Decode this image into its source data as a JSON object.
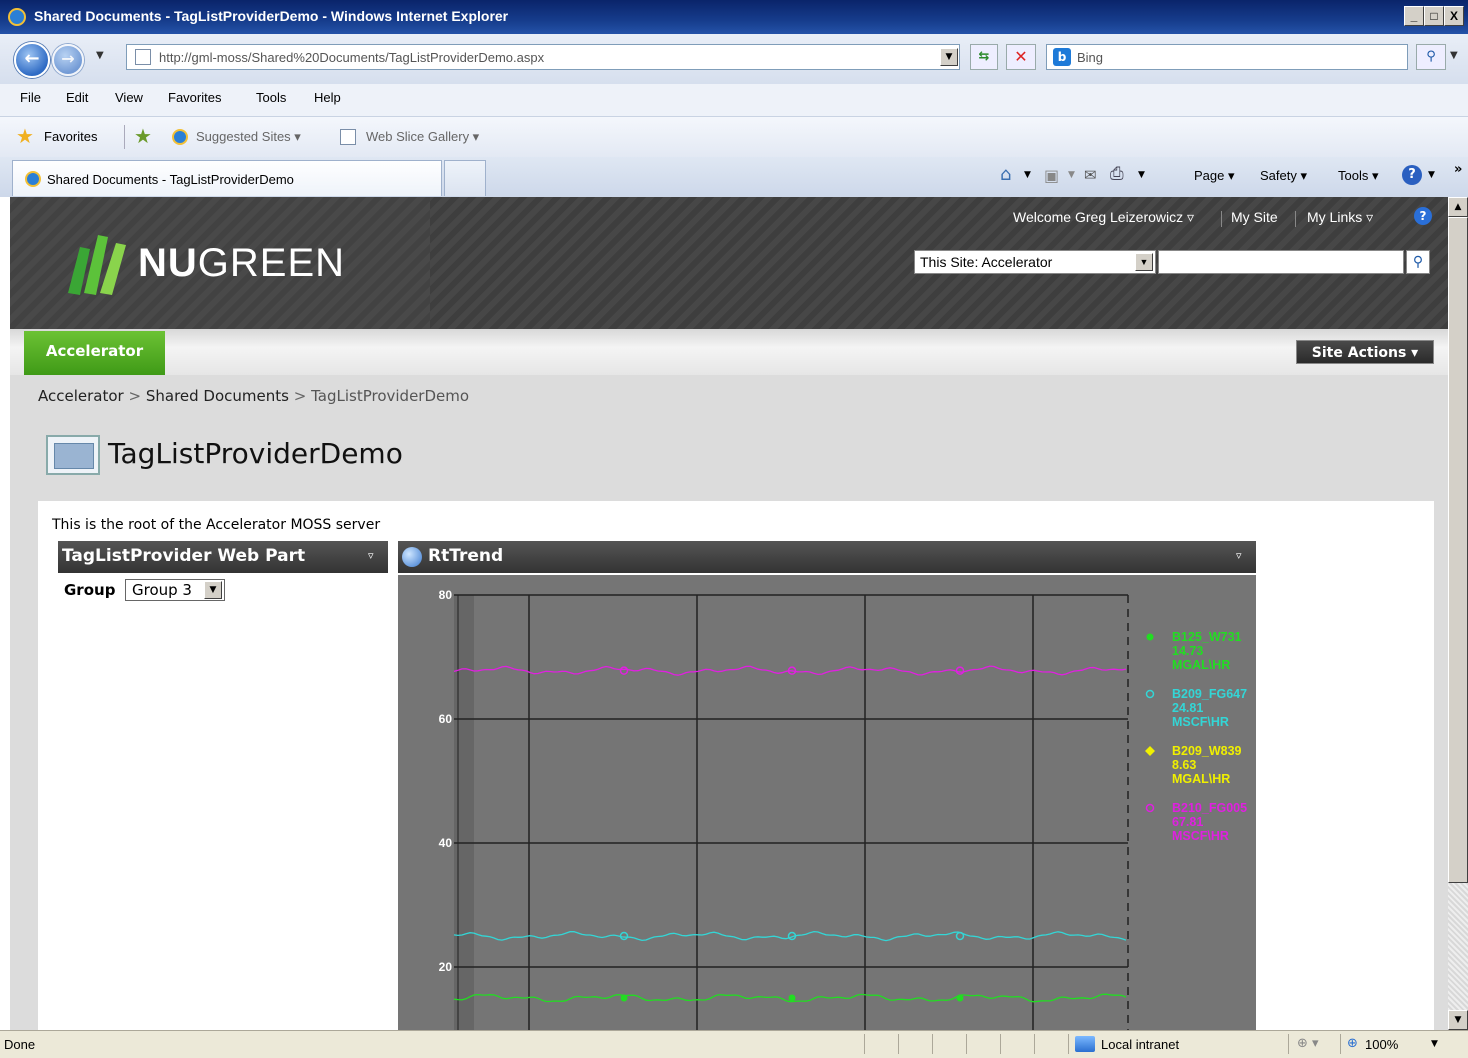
{
  "window": {
    "title": "Shared Documents - TagListProviderDemo - Windows Internet Explorer",
    "controls": [
      "_",
      "□",
      "X"
    ]
  },
  "address": {
    "url": "http://gml-moss/Shared%20Documents/TagListProviderDemo.aspx",
    "search_engine": "Bing"
  },
  "menu": [
    "File",
    "Edit",
    "View",
    "Favorites",
    "Tools",
    "Help"
  ],
  "favorites_bar": {
    "favorites_label": "Favorites",
    "items": [
      "Suggested Sites ▾",
      "Web Slice Gallery ▾"
    ]
  },
  "tabs": [
    {
      "label": "Shared Documents - TagListProviderDemo"
    }
  ],
  "command_bar": [
    "Page ▾",
    "Safety ▾",
    "Tools ▾"
  ],
  "sharepoint": {
    "welcome": "Welcome Greg Leizerowicz ▿",
    "my_site": "My Site",
    "my_links": "My Links ▿",
    "logo_bold": "NU",
    "logo_rest": "GREEN",
    "search_scope": "This Site: Accelerator",
    "site_tab": "Accelerator",
    "site_actions": "Site Actions ▾",
    "breadcrumb": [
      "Accelerator",
      "Shared Documents",
      "TagListProviderDemo"
    ],
    "breadcrumb_sep": ">",
    "page_title": "TagListProviderDemo",
    "root_note": "This is the root of the Accelerator MOSS server"
  },
  "taglist_webpart": {
    "title": "TagListProvider Web Part",
    "group_label": "Group",
    "group_value": "Group 3"
  },
  "rttrend_webpart": {
    "title": "RtTrend"
  },
  "chart_data": {
    "type": "line",
    "title": "",
    "ylim": [
      12,
      80
    ],
    "y_ticks": [
      20,
      40,
      60,
      80
    ],
    "grid": true,
    "legend_position": "right",
    "series": [
      {
        "name": "B125_W731",
        "value": "14.73",
        "unit": "MGAL\\HR",
        "color": "#22dd22",
        "marker": "dot",
        "level": 15
      },
      {
        "name": "B209_FG647",
        "value": "24.81",
        "unit": "MSCF\\HR",
        "color": "#33d6d6",
        "marker": "circle",
        "level": 25
      },
      {
        "name": "B209_W839",
        "value": "8.63",
        "unit": "MGAL\\HR",
        "color": "#f0f000",
        "marker": "diamond",
        "level": 8.63
      },
      {
        "name": "B210_FG005",
        "value": "67.81",
        "unit": "MSCF\\HR",
        "color": "#e020e0",
        "marker": "circle",
        "level": 67.8
      }
    ]
  },
  "status": {
    "left": "Done",
    "zone": "Local intranet",
    "zoom": "100%"
  }
}
